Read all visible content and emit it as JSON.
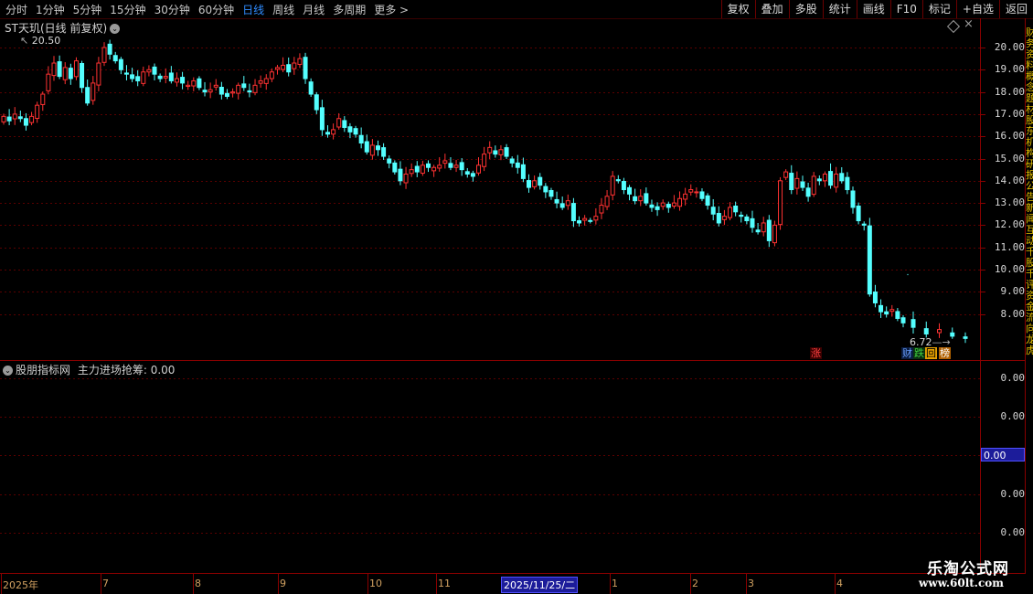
{
  "toolbar": {
    "periods": [
      "分时",
      "1分钟",
      "5分钟",
      "15分钟",
      "30分钟",
      "60分钟",
      "日线",
      "周线",
      "月线",
      "多周期",
      "更多 >"
    ],
    "active_period": "日线",
    "actions": [
      "复权",
      "叠加",
      "多股",
      "统计",
      "画线",
      "F10",
      "标记",
      "+自选",
      "返回"
    ]
  },
  "main_panel": {
    "title": "ST天玑(日线 前复权)",
    "high_label": "20.50",
    "low_label": "6.72",
    "price_axis": [
      "20.00",
      "19.00",
      "18.00",
      "17.00",
      "16.00",
      "15.00",
      "14.00",
      "13.00",
      "12.00",
      "11.00",
      "10.00",
      "9.00",
      "8.00"
    ],
    "markers": [
      {
        "text": "涨",
        "color": "#ff4040",
        "bg": "#3a0000"
      },
      {
        "text": "财",
        "color": "#6aa0ff",
        "bg": "#0a1c40"
      },
      {
        "text": "跌",
        "color": "#40d040",
        "bg": "#0a3010"
      },
      {
        "text": "回",
        "color": "#000000",
        "bg": "#e6a000"
      },
      {
        "text": "榜",
        "color": "#ffffff",
        "bg": "#b06000"
      }
    ]
  },
  "indicator_panel": {
    "source": "股朋指标网",
    "indicator": "主力进场抢筹: 0.00",
    "axis": [
      "0.00",
      "0.00",
      "0.00",
      "0.00"
    ],
    "current_value": "0.00"
  },
  "date_axis": {
    "labels": [
      "2025年",
      "7",
      "8",
      "9",
      "10",
      "11",
      "1",
      "2",
      "3",
      "4"
    ],
    "selected": "2025/11/25/二"
  },
  "watermark": {
    "name": "乐淘公式网",
    "url": "www.60lt.com"
  },
  "chart_data": {
    "type": "candlestick",
    "up_color": "#ff3232",
    "down_color": "#54ffff",
    "ylim": [
      6.5,
      21.0
    ],
    "closes": [
      16.9,
      16.7,
      17.0,
      16.8,
      16.5,
      16.9,
      17.4,
      17.9,
      18.8,
      19.3,
      18.7,
      19.1,
      18.6,
      19.4,
      18.2,
      17.5,
      18.4,
      19.3,
      20.0,
      19.7,
      19.4,
      19.0,
      18.8,
      18.6,
      18.5,
      18.9,
      19.0,
      18.8,
      18.6,
      18.7,
      18.5,
      18.6,
      18.4,
      18.3,
      18.5,
      18.2,
      18.0,
      18.1,
      18.3,
      17.9,
      17.8,
      18.0,
      18.3,
      18.2,
      18.0,
      18.3,
      18.5,
      18.6,
      18.9,
      19.1,
      19.2,
      18.9,
      19.3,
      19.5,
      18.6,
      17.9,
      17.2,
      16.3,
      16.1,
      16.3,
      16.8,
      16.4,
      16.2,
      16.1,
      15.7,
      15.3,
      15.6,
      15.4,
      15.1,
      14.8,
      14.4,
      14.0,
      14.3,
      14.5,
      14.4,
      14.7,
      14.6,
      14.6,
      14.7,
      14.9,
      14.6,
      14.7,
      14.5,
      14.3,
      14.2,
      14.7,
      15.2,
      15.5,
      15.2,
      15.4,
      15.1,
      14.8,
      14.6,
      14.1,
      13.7,
      14.0,
      13.8,
      13.5,
      13.3,
      13.0,
      12.8,
      13.1,
      12.2,
      12.1,
      12.3,
      12.2,
      12.4,
      12.9,
      13.3,
      14.2,
      14.0,
      13.6,
      13.4,
      13.1,
      13.3,
      13.0,
      12.8,
      12.7,
      13.0,
      12.8,
      13.0,
      13.2,
      13.4,
      13.6,
      13.5,
      13.2,
      12.9,
      12.5,
      12.1,
      12.4,
      12.8,
      12.6,
      12.4,
      12.2,
      11.9,
      11.7,
      12.1,
      11.3,
      12.0,
      14.0,
      14.4,
      13.6,
      14.1,
      13.7,
      13.3,
      14.2,
      14.0,
      14.3,
      13.8,
      14.3,
      14.0,
      13.6,
      12.8,
      12.2,
      12.0,
      8.9,
      8.5,
      8.1,
      8.0,
      8.2,
      7.8,
      7.6,
      7.4,
      7.1,
      7.3,
      7.0,
      6.9
    ]
  }
}
